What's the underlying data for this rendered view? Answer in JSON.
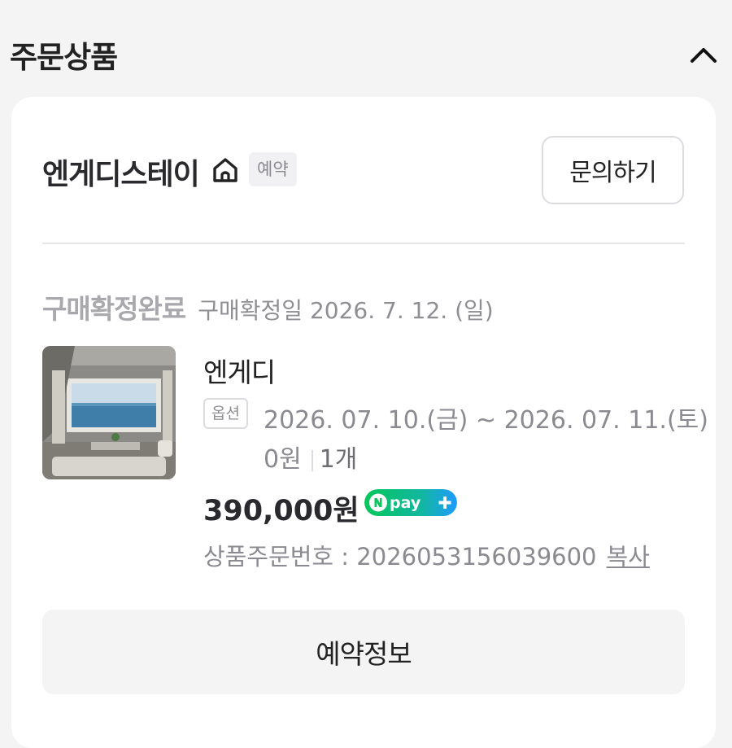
{
  "section": {
    "title": "주문상품"
  },
  "store": {
    "name": "엔게디스테이",
    "badge": "예약",
    "inquiry_label": "문의하기"
  },
  "order": {
    "status": "구매확정완료",
    "confirm_date": "구매확정일 2026. 7. 12. (일)",
    "product_name": "엔게디",
    "option_badge": "옵션",
    "option_dates": "2026. 07. 10.(금) ~ 2026. 07. 11.(토)",
    "option_price": "0원",
    "option_qty": "1개",
    "price": "390,000원",
    "npay_label": "pay",
    "order_number_label": "상품주문번호 : ",
    "order_number": "2026053156039600",
    "copy_label": "복사",
    "reservation_label": "예약정보"
  },
  "colors": {
    "npay_green": "#03c75a",
    "npay_blue": "#1e9bff"
  }
}
